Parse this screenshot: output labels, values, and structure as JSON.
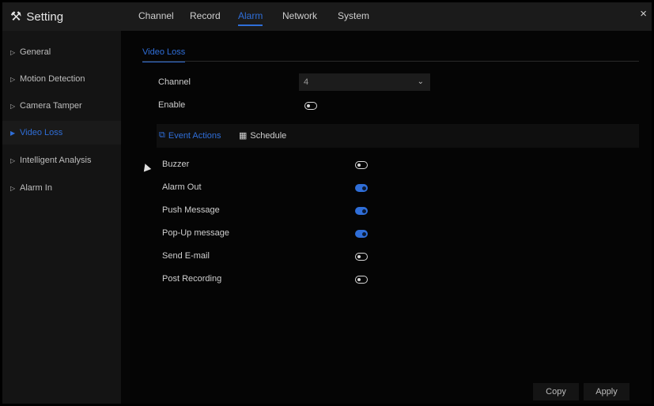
{
  "app": {
    "title": "Setting",
    "close": "×"
  },
  "top_tabs": [
    {
      "label": "Channel"
    },
    {
      "label": "Record"
    },
    {
      "label": "Alarm"
    },
    {
      "label": "Network"
    },
    {
      "label": "System"
    }
  ],
  "sidebar": {
    "items": [
      {
        "label": "General"
      },
      {
        "label": "Motion Detection"
      },
      {
        "label": "Camera Tamper"
      },
      {
        "label": "Video Loss"
      },
      {
        "label": "Intelligent Analysis"
      },
      {
        "label": "Alarm In"
      }
    ]
  },
  "main": {
    "section_tab": "Video Loss",
    "channel": {
      "label": "Channel",
      "value": "4"
    },
    "enable": {
      "label": "Enable",
      "state": "off"
    },
    "subtabs": [
      {
        "label": "Event Actions"
      },
      {
        "label": "Schedule"
      }
    ],
    "event_actions": [
      {
        "label": "Buzzer",
        "state": "off"
      },
      {
        "label": "Alarm Out",
        "state": "on"
      },
      {
        "label": "Push Message",
        "state": "on"
      },
      {
        "label": "Pop-Up message",
        "state": "on"
      },
      {
        "label": "Send E-mail",
        "state": "off"
      },
      {
        "label": "Post Recording",
        "state": "off"
      }
    ],
    "buttons": {
      "copy": "Copy",
      "apply": "Apply"
    }
  },
  "colors": {
    "accent": "#2f6ed8",
    "background": "#050505",
    "sidebar": "#141414"
  }
}
